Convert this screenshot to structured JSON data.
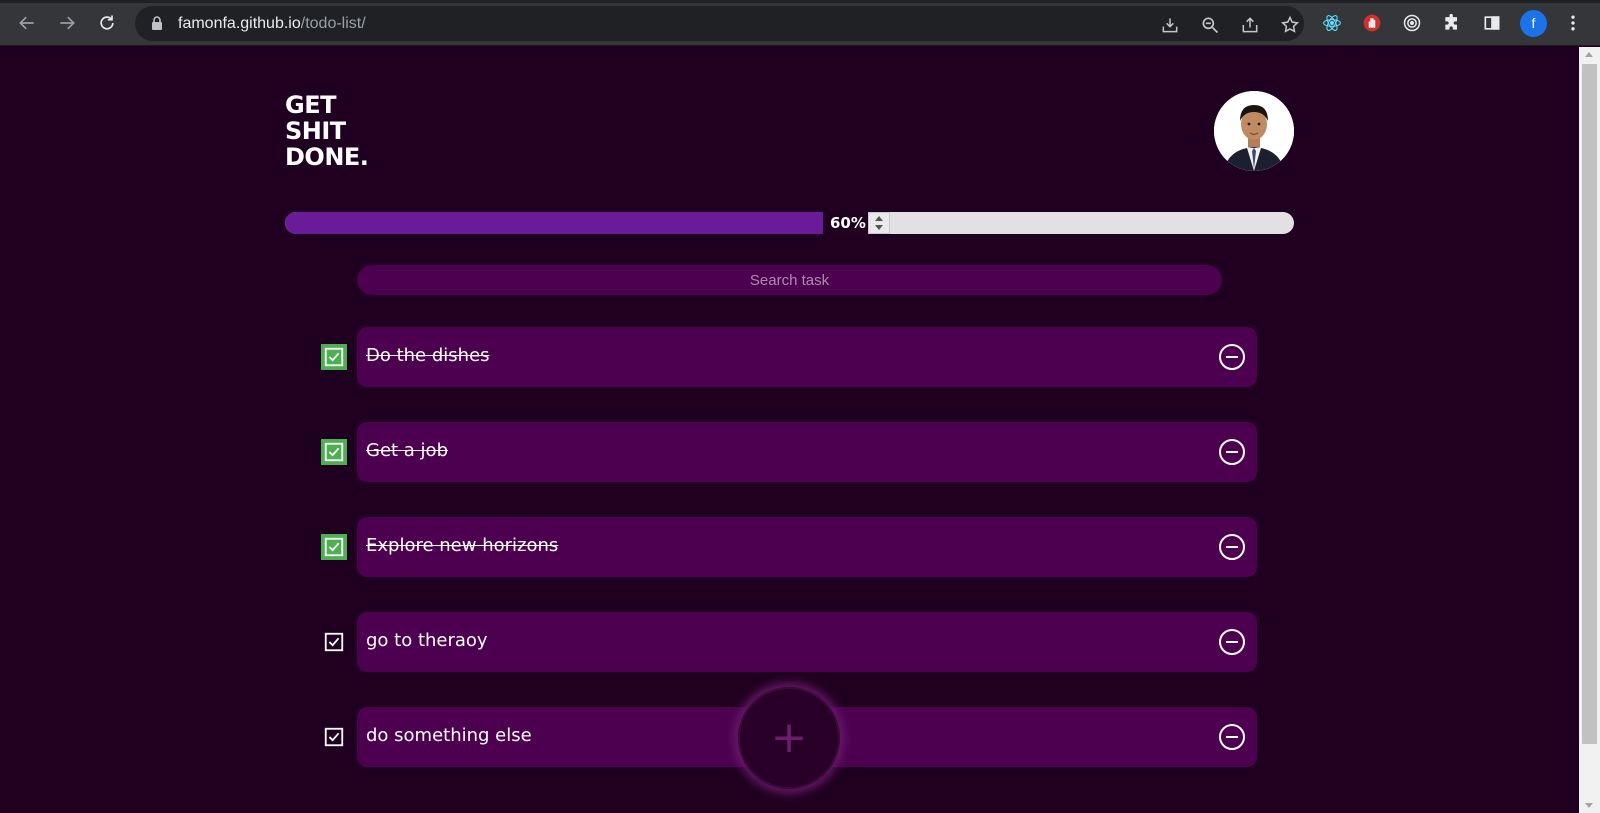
{
  "browser": {
    "url_domain": "famonfa.github.io",
    "url_path": "/todo-list/",
    "profile_initial": "f",
    "icons": [
      "back-icon",
      "forward-icon",
      "reload-icon",
      "lock-icon",
      "install-icon",
      "zoom-icon",
      "share-icon",
      "bookmark-star-icon",
      "react-devtools-icon",
      "extension-hand-icon",
      "extension-target-icon",
      "extensions-puzzle-icon",
      "side-panel-icon",
      "menu-kebab-icon"
    ]
  },
  "app": {
    "title_lines": [
      "GET",
      "SHIT",
      "DONE."
    ],
    "progress": {
      "value": 0.6,
      "label": "60%"
    },
    "search": {
      "placeholder": "Search task",
      "value": ""
    },
    "todos": [
      {
        "text": "Do the dishes",
        "completed": true
      },
      {
        "text": "Get a job",
        "completed": true
      },
      {
        "text": "Explore new horizons",
        "completed": true
      },
      {
        "text": "go to theraoy",
        "completed": false
      },
      {
        "text": "do something else",
        "completed": false
      }
    ],
    "add_button": "+"
  },
  "colors": {
    "page_bg": "#1f0020",
    "card_bg": "#4e0050",
    "progress_fill": "#6a1b9a",
    "progress_track": "#e3e0e3",
    "check_done": "#4caf50"
  }
}
